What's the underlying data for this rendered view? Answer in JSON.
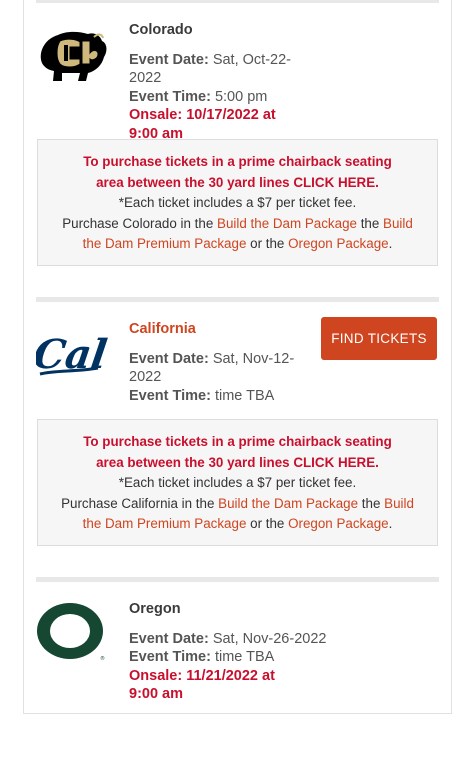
{
  "colors": {
    "accent": "#cf4520",
    "alert_red": "#c8102e"
  },
  "labels": {
    "event_date": "Event Date:",
    "event_time": "Event Time:"
  },
  "games": [
    {
      "team": "Colorado",
      "logo_icon": "colorado-buffaloes-logo-icon",
      "event_date": "Sat, Oct-22-2022",
      "event_time": "5:00 pm",
      "onsale_line1": "Onsale: 10/17/2022 at",
      "onsale_line2": "9:00 am",
      "notice": {
        "line1": "To purchase tickets in a prime chairback seating",
        "line2_pre": "area between the 30 yard lines ",
        "click_here": "CLICK HERE.",
        "fee": "*Each ticket includes a $7 per ticket fee.",
        "purchase_pre": "Purchase Colorado in the ",
        "link1": "Build the Dam Package",
        "mid": " the ",
        "link2a": "Build",
        "link2b": "the Dam Premium Package",
        "or": " or the ",
        "link3": "Oregon Package",
        "end": "."
      }
    },
    {
      "team": "California",
      "logo_icon": "cal-bears-logo-icon",
      "event_date_line1": "Sat, Nov-12-",
      "event_date_line2": "2022",
      "event_time": "time TBA",
      "button": "FIND TICKETS",
      "notice": {
        "line1": "To purchase tickets in a prime chairback seating",
        "line2_pre": "area between the 30 yard lines ",
        "click_here": "CLICK HERE.",
        "fee": "*Each ticket includes a $7 per ticket fee.",
        "purchase_pre": "Purchase California in the ",
        "link1": "Build the Dam Package",
        "mid": " the ",
        "link2a": "Build",
        "link2b": "the Dam Premium Package",
        "or": " or the ",
        "link3": "Oregon Package",
        "end": "."
      }
    },
    {
      "team": "Oregon",
      "logo_icon": "oregon-o-logo-icon",
      "event_date": "Sat, Nov-26-2022",
      "event_time": "time TBA",
      "onsale_line1": "Onsale: 11/21/2022 at",
      "onsale_line2": "9:00 am"
    }
  ]
}
